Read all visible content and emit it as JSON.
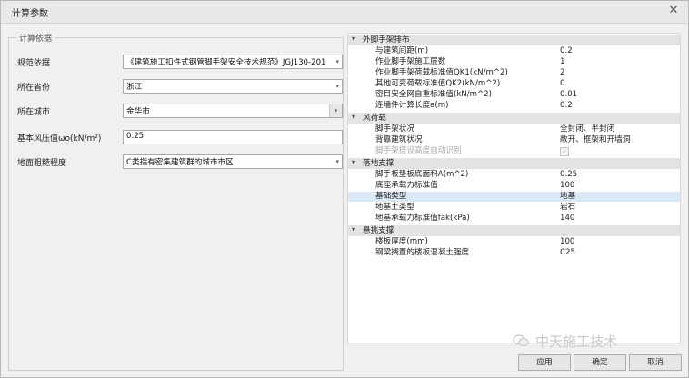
{
  "window": {
    "title": "计算参数"
  },
  "left_panel": {
    "group_title": "计算依据",
    "fields": [
      {
        "label": "规范依据",
        "value": "《建筑施工扣件式钢管脚手架安全技术规范》JGJ130-201"
      },
      {
        "label": "所在省份",
        "value": "浙江"
      },
      {
        "label": "所在城市",
        "value": "金华市"
      },
      {
        "label": "基本风压值ωo(kN/m²)",
        "value": "0.25"
      },
      {
        "label": "地面粗糙程度",
        "value": "C类指有密集建筑群的城市市区"
      }
    ]
  },
  "property_grid": {
    "categories": [
      {
        "title": "外脚手架排布",
        "rows": [
          {
            "name": "与建筑间距(m)",
            "value": "0.2"
          },
          {
            "name": "作业脚手架施工层数",
            "value": "1"
          },
          {
            "name": "作业脚手架荷载标准值QK1(kN/m^2)",
            "value": "2"
          },
          {
            "name": "其他可变荷载标准值QK2(kN/m^2)",
            "value": "0"
          },
          {
            "name": "密目安全网自重标准值(kN/m^2)",
            "value": "0.01"
          },
          {
            "name": "连墙件计算长度a(m)",
            "value": "0.2"
          }
        ]
      },
      {
        "title": "风荷载",
        "rows": [
          {
            "name": "脚手架状况",
            "value": "全封闭、半封闭"
          },
          {
            "name": "背靠建筑状况",
            "value": "敞开、框架和开墙洞"
          },
          {
            "name": "脚手架搭设高度自动识别",
            "value": "✓"
          }
        ]
      },
      {
        "title": "落地支撑",
        "rows": [
          {
            "name": "脚手板垫板底面积A(m^2)",
            "value": "0.25"
          },
          {
            "name": "底座承载力标准值",
            "value": "100"
          },
          {
            "name": "基础类型",
            "value": "地基"
          },
          {
            "name": "地基土类型",
            "value": "岩石"
          },
          {
            "name": "地基承载力标准值fak(kPa)",
            "value": "140"
          }
        ]
      },
      {
        "title": "悬挑支撑",
        "rows": [
          {
            "name": "楼板厚度(mm)",
            "value": "100"
          },
          {
            "name": "钢梁搁置的楼板混凝土强度",
            "value": "C25"
          }
        ]
      }
    ]
  },
  "watermark": "中天施工技术",
  "buttons": {
    "apply": "应用",
    "ok": "确定",
    "cancel": "取消"
  },
  "colors": {
    "selected_row": "#dbe8f5",
    "category_bg": "#e3e3e3",
    "dialog_bg": "#f0f0f0"
  }
}
